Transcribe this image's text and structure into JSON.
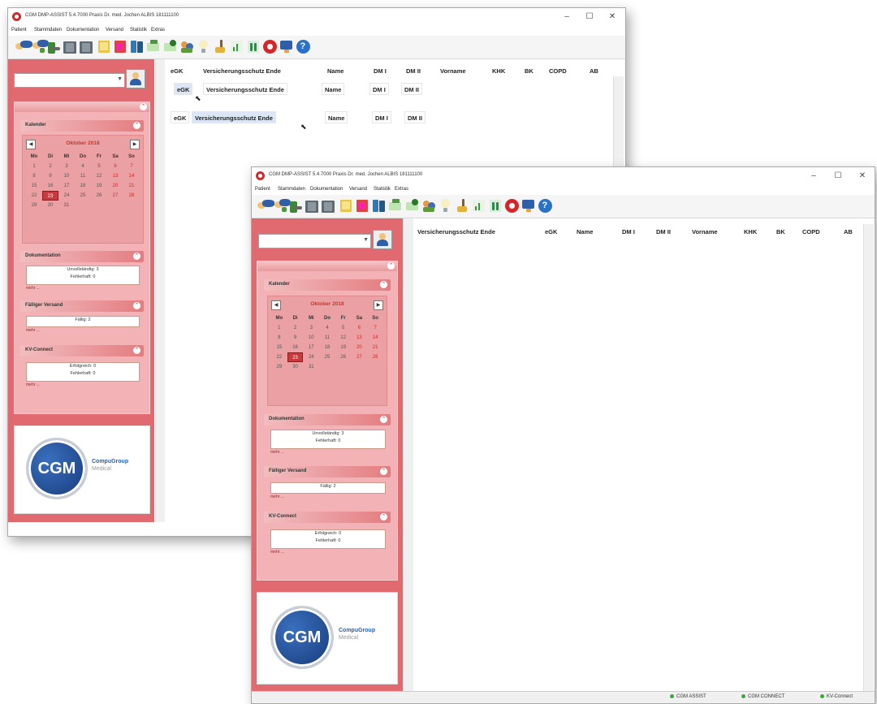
{
  "window_back": {
    "title": "CGM DMP-ASSIST 5.4.7000 Praxis Dr. med. Jochen ALBIS 181111100",
    "menu": [
      "Patient",
      "Stammdaten",
      "Dokumentation",
      "Versand",
      "Statistik",
      "Extras"
    ],
    "columns": [
      "eGK",
      "Versicherungsschutz Ende",
      "Name",
      "DM I",
      "DM II",
      "Vorname",
      "KHK",
      "BK",
      "COPD",
      "AB"
    ],
    "drag_row1": [
      "eGK",
      "Versicherungsschutz Ende",
      "Name",
      "DM I",
      "DM II"
    ],
    "drag_row2": [
      "eGK",
      "Versicherungsschutz Ende",
      "Name",
      "DM I",
      "DM II"
    ]
  },
  "window_front": {
    "title": "CGM DMP-ASSIST 5.4.7000 Praxis Dr. med. Jochen ALBIS 181111100",
    "menu": [
      "Patient",
      "Stammdaten",
      "Dokumentation",
      "Versand",
      "Statistik",
      "Extras"
    ],
    "columns": [
      "Versicherungsschutz Ende",
      "eGK",
      "Name",
      "DM I",
      "DM II",
      "Vorname",
      "KHK",
      "BK",
      "COPD",
      "AB"
    ],
    "status": [
      "CGM ASSIST",
      "CGM CONNECT",
      "KV-Connect"
    ]
  },
  "window_buttons": {
    "minimize": "–",
    "maximize": "☐",
    "close": "✕"
  },
  "calendar": {
    "title": "Kalender",
    "month": "Oktober 2018",
    "prev": "◀",
    "next": "▶",
    "weekdays": [
      "Mo",
      "Di",
      "Mi",
      "Do",
      "Fr",
      "Sa",
      "So"
    ],
    "days": [
      "1",
      "2",
      "3",
      "4",
      "5",
      "6",
      "7",
      "8",
      "9",
      "10",
      "11",
      "12",
      "13",
      "14",
      "15",
      "16",
      "17",
      "18",
      "19",
      "20",
      "21",
      "22",
      "23",
      "24",
      "25",
      "26",
      "27",
      "28",
      "29",
      "30",
      "31"
    ],
    "selected_day": "23"
  },
  "sections": {
    "dokumentation": {
      "title": "Dokumentation",
      "line1": "Unvollständig: 3",
      "line2": "Fehlerhaft: 0",
      "more": "mehr ..."
    },
    "versand": {
      "title": "Fälliger Versand",
      "line1": "Fällig: 2",
      "more": "mehr ..."
    },
    "kvconnect": {
      "title": "KV-Connect",
      "line1": "Erfolgreich: 0",
      "line2": "Fehlerhaft: 0",
      "more": "mehr ..."
    }
  },
  "logo": {
    "text": "CGM",
    "company": "CompuGroup",
    "sub": "Medical"
  },
  "icons": [
    "patient-icon",
    "patient-edit-icon",
    "export-icon",
    "book-icon",
    "book-icon",
    "note-icon",
    "note-red-icon",
    "books-icon",
    "mail-icon",
    "mail-check-icon",
    "users-icon",
    "bulb-icon",
    "broom-icon",
    "chart-icon",
    "table-icon",
    "lifebuoy-icon",
    "monitor-icon",
    "help-icon"
  ],
  "colors": {
    "sidebar": "#e06a6f",
    "accent_red": "#d4272a",
    "cgm_blue": "#1f4f9a"
  }
}
